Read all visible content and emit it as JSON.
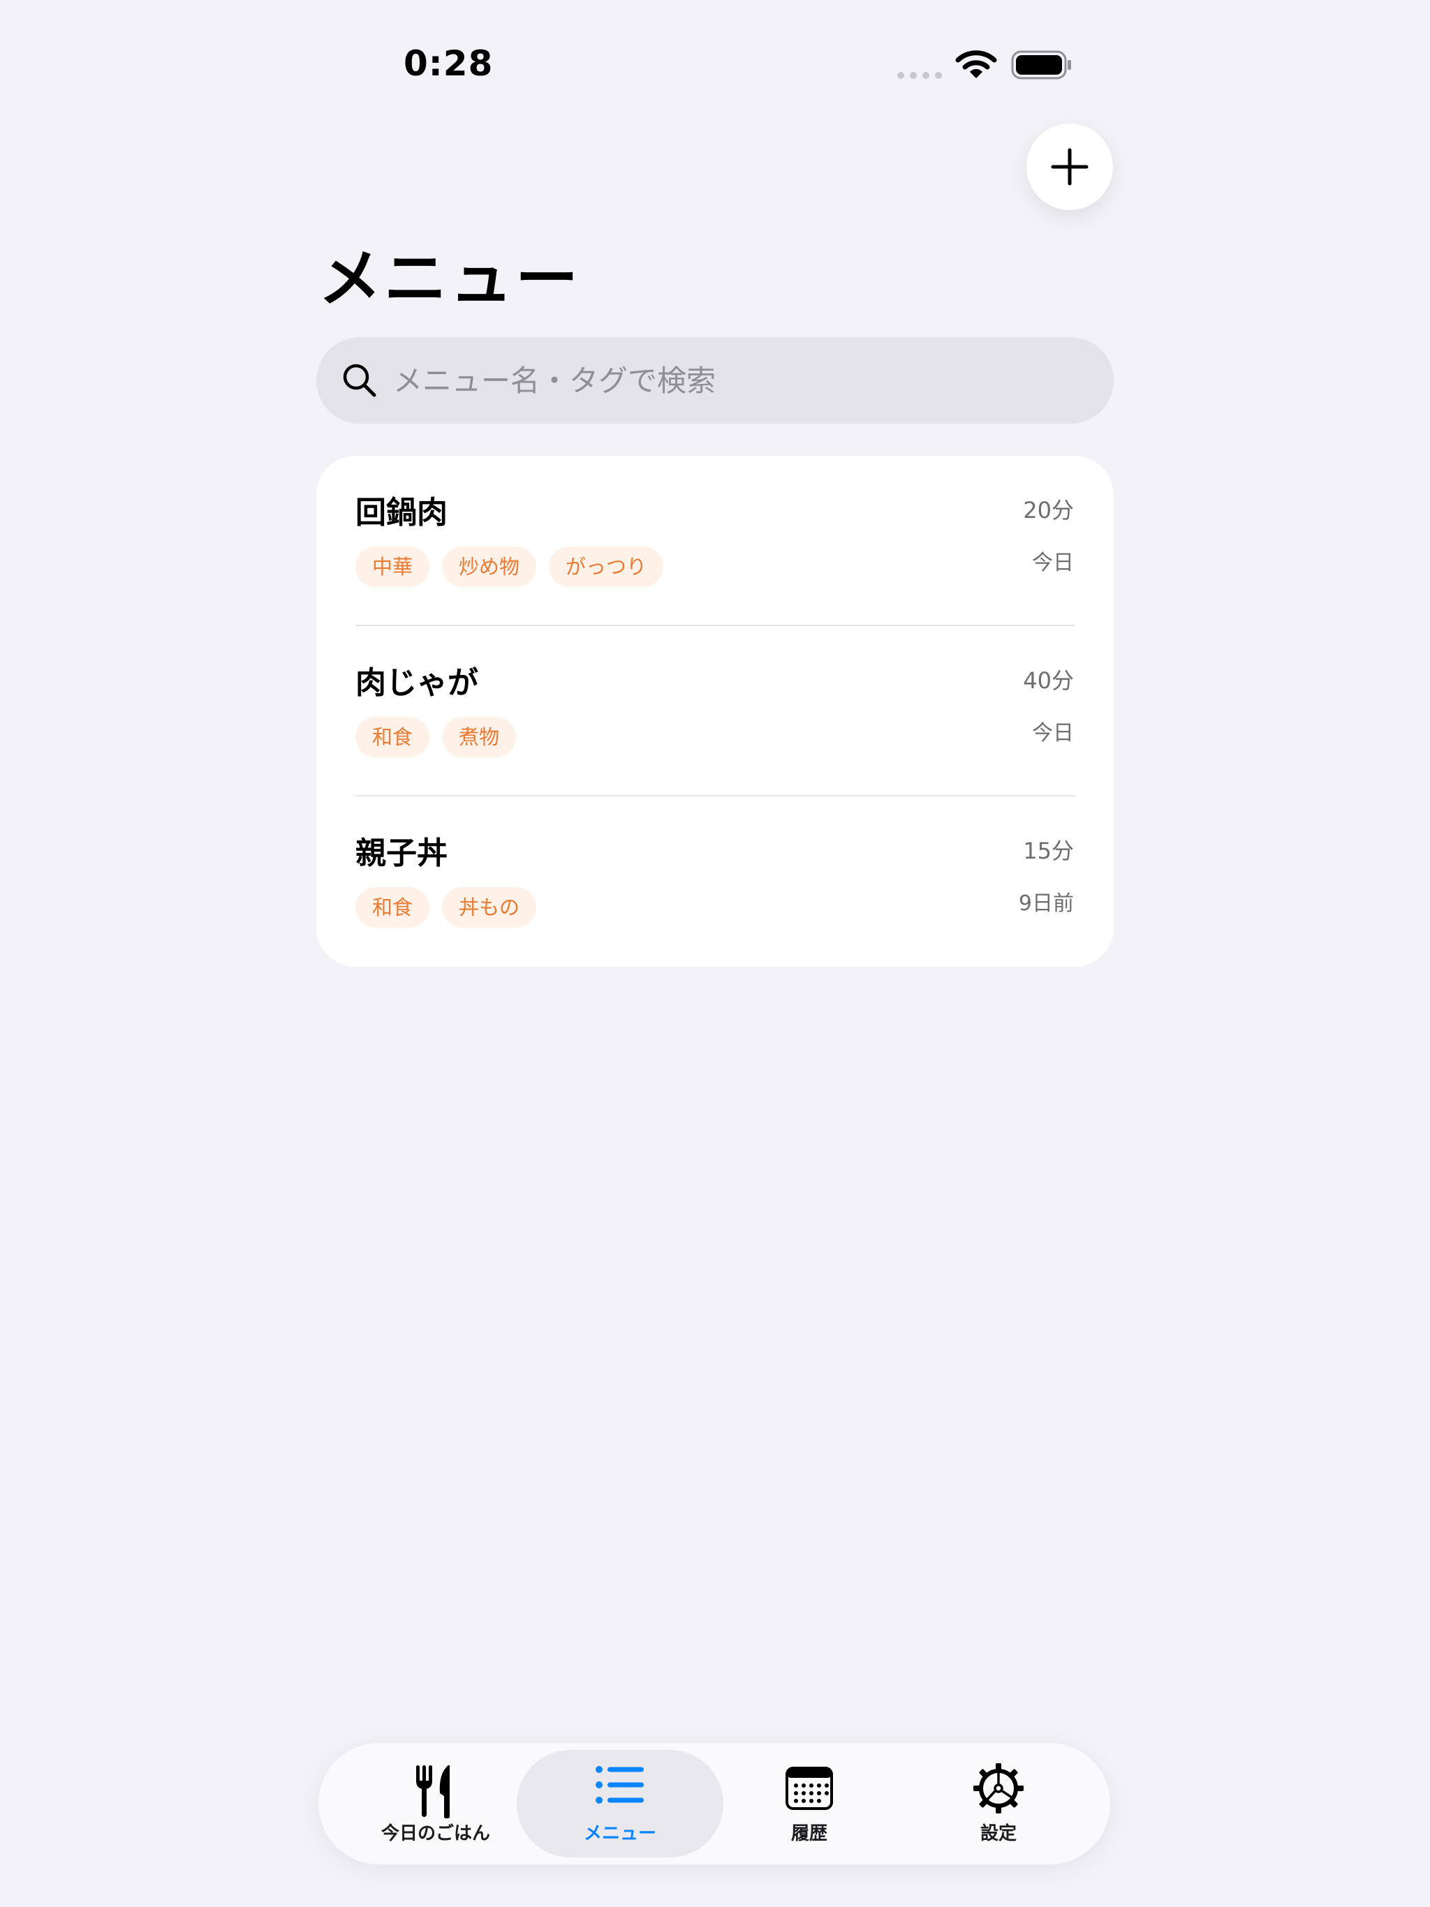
{
  "status_bar": {
    "time": "0:28"
  },
  "header": {
    "title": "メニュー",
    "add_icon": "plus-icon"
  },
  "search": {
    "placeholder": "メニュー名・タグで検索",
    "value": "",
    "icon": "search-icon"
  },
  "menus": [
    {
      "name": "回鍋肉",
      "time": "20分",
      "last": "今日",
      "tags": [
        "中華",
        "炒め物",
        "がっつり"
      ]
    },
    {
      "name": "肉じゃが",
      "time": "40分",
      "last": "今日",
      "tags": [
        "和食",
        "煮物"
      ]
    },
    {
      "name": "親子丼",
      "time": "15分",
      "last": "9日前",
      "tags": [
        "和食",
        "丼もの"
      ]
    }
  ],
  "tab_bar": {
    "active": "menu",
    "tabs": [
      {
        "id": "today",
        "label": "今日のごはん",
        "icon": "fork-knife-icon"
      },
      {
        "id": "menu",
        "label": "メニュー",
        "icon": "list-icon"
      },
      {
        "id": "history",
        "label": "履歴",
        "icon": "calendar-icon"
      },
      {
        "id": "settings",
        "label": "設定",
        "icon": "gear-icon"
      }
    ]
  },
  "colors": {
    "background": "#f2f2f7",
    "card": "#ffffff",
    "tag_bg": "#fdf1e8",
    "tag_text": "#ea7b33",
    "accent": "#0a84ff",
    "secondary_text": "#6d6d72"
  }
}
